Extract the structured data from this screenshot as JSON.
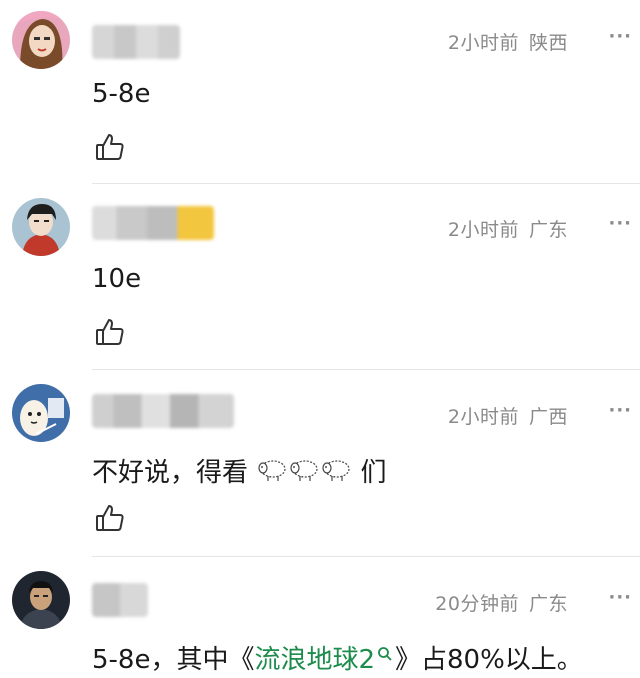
{
  "comments": [
    {
      "time": "2小时前",
      "location": "陕西",
      "text": "5-8e",
      "more": "···",
      "colors": {
        "avatar_bg": "#d98aa8",
        "avatar_accent": "#7a4b2a"
      }
    },
    {
      "time": "2小时前",
      "location": "广东",
      "text": "10e",
      "more": "···",
      "colors": {
        "avatar_bg": "#9fb8c8",
        "avatar_accent": "#c0392b"
      }
    },
    {
      "time": "2小时前",
      "location": "广西",
      "text_before": "不好说，得看",
      "text_after": "们",
      "sheep_icon": "sheep-emoji",
      "more": "···",
      "colors": {
        "avatar_bg": "#3f6ea8",
        "avatar_accent": "#ffffff"
      }
    },
    {
      "time": "20分钟前",
      "location": "广东",
      "text_before": "5-8e，其中《",
      "link_text": "流浪地球2",
      "link_icon": "search-icon",
      "text_after": "》占80%以上。",
      "more": "···",
      "colors": {
        "avatar_bg": "#2c3440",
        "avatar_accent": "#d6b48a"
      }
    }
  ],
  "icons": {
    "like": "thumbs-up-icon",
    "more": "more-dots-icon"
  },
  "colors": {
    "meta": "#8a8a8a",
    "link": "#1d8c4c",
    "divider": "#e6e6e6"
  }
}
